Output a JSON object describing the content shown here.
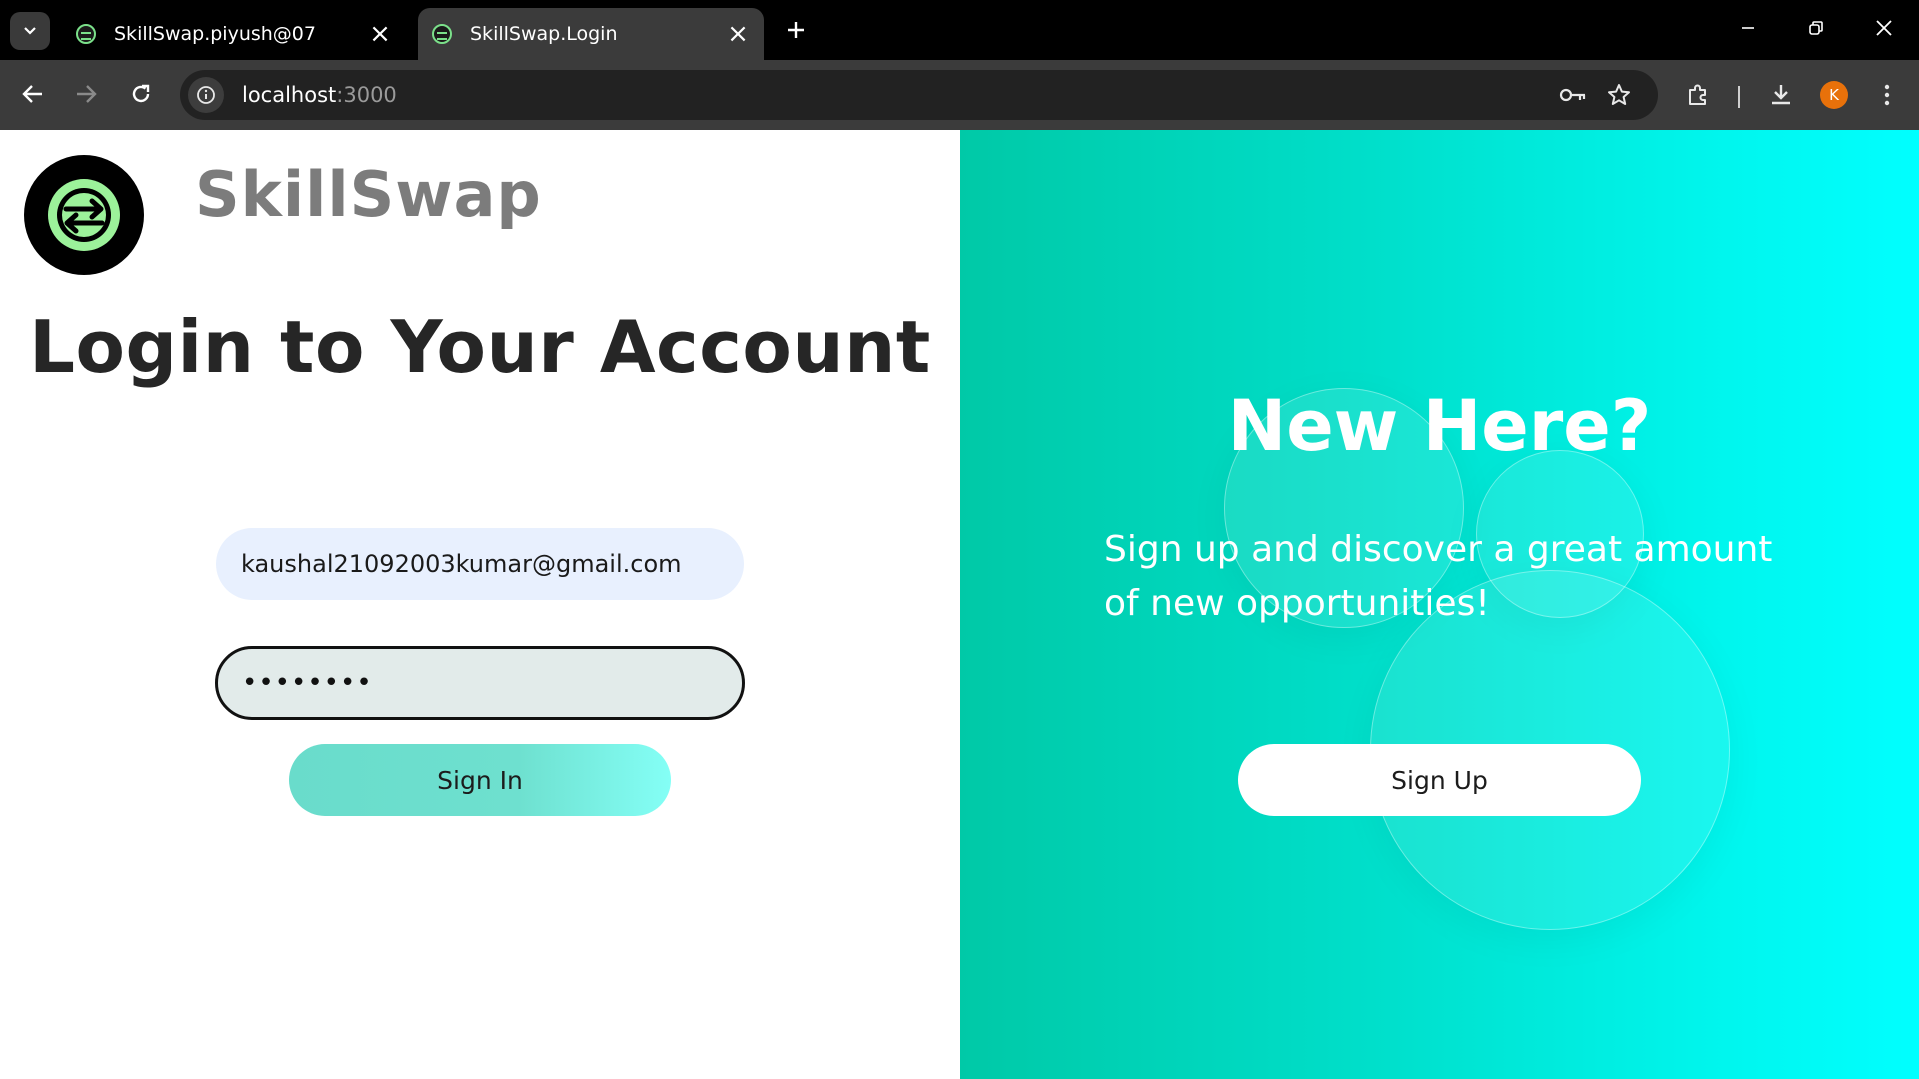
{
  "browser": {
    "tabs": [
      {
        "title": "SkillSwap.piyush@07",
        "active": false
      },
      {
        "title": "SkillSwap.Login",
        "active": true
      }
    ],
    "url_host": "localhost",
    "url_port": ":3000",
    "profile_initial": "K",
    "icons": {
      "tab_search": "chevron-down-icon",
      "tab_close": "close-icon",
      "new_tab": "plus-icon",
      "minimize": "minimize-icon",
      "restore": "restore-icon",
      "close_window": "close-icon",
      "back": "back-arrow-icon",
      "forward": "forward-arrow-icon",
      "reload": "reload-icon",
      "site_info": "info-icon",
      "password_key": "key-icon",
      "bookmark": "star-icon",
      "extensions": "puzzle-icon",
      "downloads": "download-icon",
      "menu": "kebab-menu-icon"
    }
  },
  "login": {
    "brand": "SkillSwap",
    "title": "Login to Your Account",
    "email_value": "kaushal21092003kumar@gmail.com",
    "password_value": "••••••••",
    "sign_in_label": "Sign In"
  },
  "signup_panel": {
    "title": "New Here?",
    "text": "Sign up and discover a great amount of new opportunities!",
    "sign_up_label": "Sign Up"
  },
  "colors": {
    "panel_gradient_start": "#00c9a7",
    "panel_gradient_end": "#00ffff",
    "email_bg": "#e8f0fe",
    "signin_gradient": "#69dccb",
    "logo_accent": "#7be08a"
  }
}
